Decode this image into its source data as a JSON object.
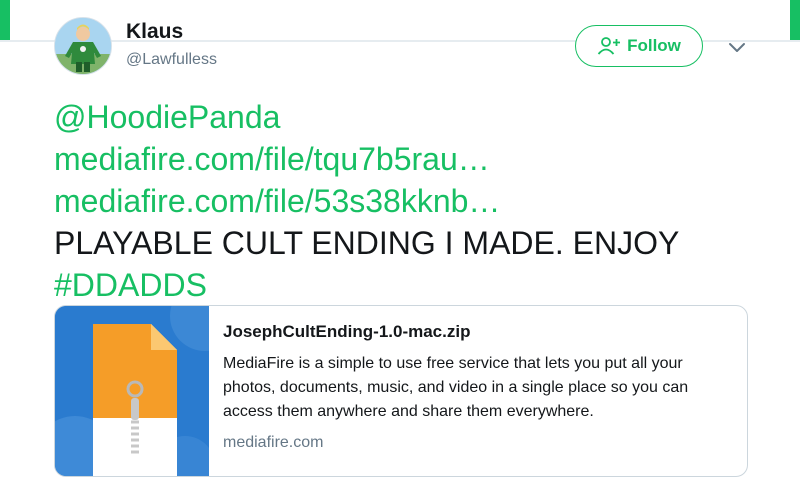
{
  "theme": {
    "accent": "#17bf63",
    "text": "#14171a",
    "muted": "#657786",
    "border": "#ccd6dd"
  },
  "author": {
    "display_name": "Klaus",
    "handle": "@Lawfulless",
    "avatar_icon": "character-avatar"
  },
  "actions": {
    "follow_label": "Follow",
    "follow_icon": "add-user-icon",
    "menu_icon": "chevron-down-icon"
  },
  "tweet": {
    "mention": "@HoodiePanda",
    "link1": "mediafire.com/file/tqu7b5rau…",
    "link2": "mediafire.com/file/53s38kknb…",
    "body": "PLAYABLE CULT ENDING I MADE. ENJOY",
    "hashtag": "#DDADDS"
  },
  "card": {
    "title": "JosephCultEnding-1.0-mac.zip",
    "description": "MediaFire is a simple to use free service that lets you put all your photos, documents, music, and video in a single place so you can access them anywhere and share them everywhere.",
    "domain": "mediafire.com",
    "thumb_icon": "zip-file-icon"
  }
}
